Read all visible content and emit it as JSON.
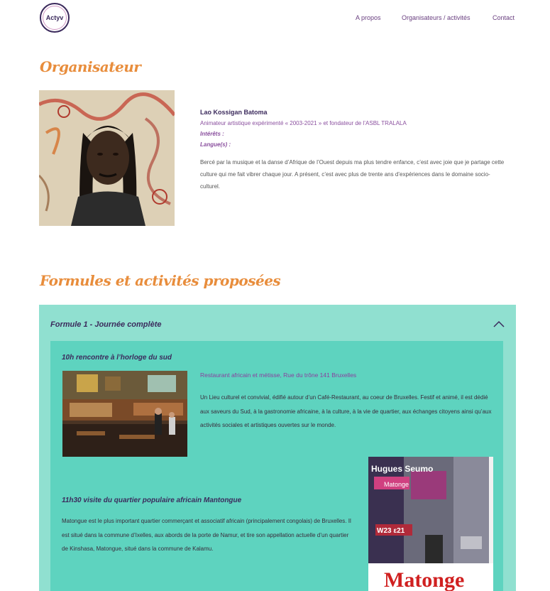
{
  "header": {
    "logo_text": "Actyv",
    "nav": [
      "A propos",
      "Organisateurs / activités",
      "Contact"
    ]
  },
  "organizer": {
    "section_title": "Organisateur",
    "name": "Lao Kossigan Batoma",
    "role": "Animateur artistique expérimenté « 2003-2021 » et fondateur de l’ASBL TRALALA",
    "interests_label": "Intérêts :",
    "languages_label": "Langue(s) :",
    "bio": "Bercé par la musique et la danse d’Afrique de l’Ouest depuis ma plus tendre enfance, c’est avec joie que je partage cette culture qui me fait vibrer chaque jour. A présent, c’est avec plus de trente ans d’expériences dans le domaine socio-culturel."
  },
  "activities": {
    "section_title": "Formules et activités proposées",
    "formula_title": "Formule 1 - Journée complète",
    "items": [
      {
        "title": "10h rencontre à l’horloge du sud",
        "address": "Restaurant africain et métisse, Rue du trône 141 Bruxelles",
        "description": "Un Lieu culturel et convivial, édifié autour d’un Café-Restaurant, au coeur de Bruxelles. Festif et animé, il est dédié aux saveurs du Sud, à la gastronomie africaine, à la culture, à la vie de quartier, aux échanges citoyens ainsi qu’aux activités sociales et artistiques ouvertes sur le monde."
      },
      {
        "title": "11h30 visite du quartier populaire africain Mantongue",
        "description": "Matongue est le plus important quartier commerçant et associatif africain (principalement congolais) de Bruxelles. Il est situé dans la commune d’Ixelles, aux abords de la porte de Namur, et tire son appellation actuelle d’un quartier de Kinshasa, Matongue, situé dans la commune de Kalamu."
      }
    ],
    "book": {
      "author": "Hugues Seumo",
      "title": "Matonge",
      "sign_text": "W23 ε21",
      "shop_sign": "Matonge"
    }
  },
  "colors": {
    "accent_orange": "#e88d3c",
    "purple": "#3b2a5c",
    "accordion_bg": "#90e0d0",
    "panel_bg": "#5ed3bf"
  }
}
